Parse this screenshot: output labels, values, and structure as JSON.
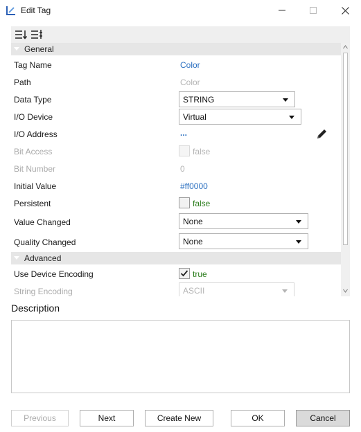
{
  "window": {
    "title": "Edit Tag"
  },
  "categories": {
    "general": "General",
    "advanced": "Advanced"
  },
  "props": {
    "tag_name": {
      "label": "Tag Name",
      "value": "Color"
    },
    "path": {
      "label": "Path",
      "value": "Color"
    },
    "data_type": {
      "label": "Data Type",
      "value": "STRING"
    },
    "io_device": {
      "label": "I/O Device",
      "value": "Virtual"
    },
    "io_address": {
      "label": "I/O Address",
      "value": "..."
    },
    "bit_access": {
      "label": "Bit Access",
      "value": "false",
      "checked": false
    },
    "bit_number": {
      "label": "Bit Number",
      "value": "0"
    },
    "initial_value": {
      "label": "Initial Value",
      "value": "#ff0000"
    },
    "persistent": {
      "label": "Persistent",
      "value": "false",
      "checked": false
    },
    "value_changed": {
      "label": "Value Changed",
      "value": "None"
    },
    "quality_changed": {
      "label": "Quality Changed",
      "value": "None"
    },
    "use_device_encoding": {
      "label": "Use Device Encoding",
      "value": "true",
      "checked": true
    },
    "string_encoding": {
      "label": "String Encoding",
      "value": "ASCII"
    }
  },
  "description": {
    "title": "Description",
    "value": ""
  },
  "buttons": {
    "previous": "Previous",
    "next": "Next",
    "create_new": "Create New",
    "ok": "OK",
    "cancel": "Cancel"
  },
  "colors": {
    "link": "#2a6fc0",
    "bool_value": "#2b7d1c",
    "category_bg": "#e6e6e6"
  }
}
